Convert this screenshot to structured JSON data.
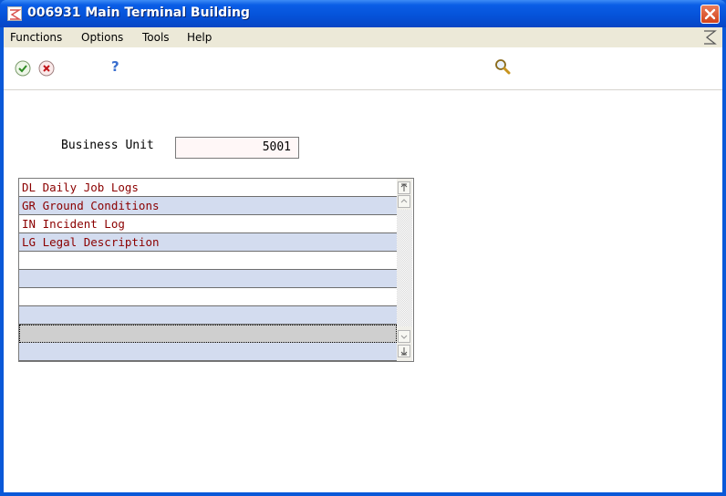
{
  "window": {
    "title": "006931 Main Terminal Building"
  },
  "menu": {
    "items": [
      {
        "label": "Functions"
      },
      {
        "label": "Options"
      },
      {
        "label": "Tools"
      },
      {
        "label": "Help"
      }
    ]
  },
  "toolbar": {
    "buttons": [
      {
        "icon": "check-icon",
        "label": "OK"
      },
      {
        "icon": "cancel-icon",
        "label": "Cancel"
      },
      {
        "icon": "help-icon",
        "label": "Help"
      },
      {
        "icon": "search-icon",
        "label": "Find"
      }
    ]
  },
  "form": {
    "business_unit_label": "Business Unit",
    "business_unit_value": "5001"
  },
  "grid": {
    "rows": [
      {
        "text": "DL Daily Job Logs"
      },
      {
        "text": "GR Ground Conditions"
      },
      {
        "text": "IN Incident Log"
      },
      {
        "text": "LG Legal Description"
      },
      {
        "text": ""
      },
      {
        "text": ""
      },
      {
        "text": ""
      },
      {
        "text": ""
      },
      {
        "text": ""
      },
      {
        "text": ""
      }
    ]
  },
  "colors": {
    "title_bar": "#0552d8",
    "row_text": "#8b0000",
    "row_alt": "#d3dcef",
    "input_bg": "#fff7f7"
  }
}
